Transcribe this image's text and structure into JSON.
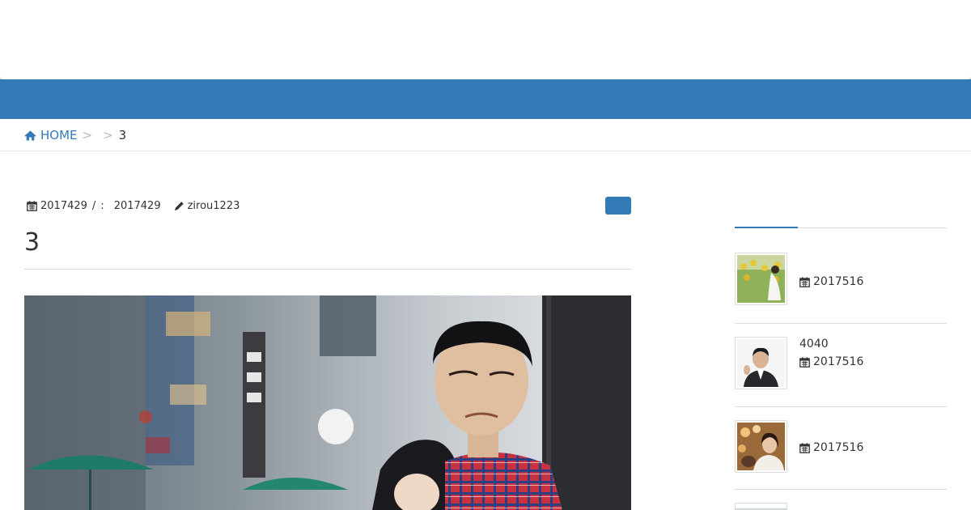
{
  "breadcrumb": {
    "home_label": "HOME",
    "separator": ">",
    "current": "3"
  },
  "post": {
    "published_date": "2017429",
    "date_separator": "/",
    "updated_label": ":",
    "updated_date": "2017429",
    "author": "zirou1223",
    "title": "3"
  },
  "sidebar": {
    "items": [
      {
        "title": "",
        "date": "2017516"
      },
      {
        "title": "4040",
        "date": "2017516"
      },
      {
        "title": "",
        "date": "2017516"
      }
    ]
  },
  "colors": {
    "accent": "#337ab7"
  },
  "icons": [
    "home-icon",
    "calendar-icon",
    "pencil-icon"
  ]
}
